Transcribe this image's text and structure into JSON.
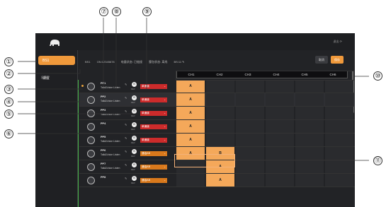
{
  "app": {
    "top_right_label": "退出 ⟳",
    "sidebar_items": [
      {
        "label": "BS1",
        "active": true
      },
      {
        "label": "设置",
        "active": false
      }
    ],
    "info": {
      "name_prefix": "BS1",
      "id": "ON:12345678",
      "battery": "电量状态: 已链接",
      "belt": "腰包状态: 离线",
      "bs": "BS:11 ✎"
    },
    "buttons": {
      "cancel": "取消",
      "save": "保存"
    },
    "list_header": "设备",
    "channels": [
      "CH1",
      "CH2",
      "CH3",
      "CH4",
      "CH5",
      "CH6"
    ],
    "devices": [
      {
        "name": "PP1",
        "sub": "Talk&Voice Listen",
        "badge": "B",
        "badge_sub": "DEV",
        "mode": "单通道",
        "mode_color": "red",
        "cells": [
          "A",
          "",
          "",
          "",
          "",
          ""
        ],
        "selected": false
      },
      {
        "name": "PP2",
        "sub": "Talk&Voice Listen",
        "badge": "B",
        "badge_sub": "DEV",
        "mode": "单通道",
        "mode_color": "red",
        "cells": [
          "A",
          "",
          "",
          "",
          "",
          ""
        ],
        "selected": true
      },
      {
        "name": "PP3",
        "sub": "Talk&Voice Listen",
        "badge": "B",
        "badge_sub": "DEV",
        "mode": "单通道",
        "mode_color": "red",
        "cells": [
          "A",
          "",
          "",
          "",
          "",
          ""
        ],
        "selected": false
      },
      {
        "name": "PP4",
        "sub": "",
        "badge": "B",
        "badge_sub": "DEV",
        "mode": "单通道",
        "mode_color": "red",
        "cells": [
          "A",
          "",
          "",
          "",
          "",
          ""
        ],
        "selected": false
      },
      {
        "name": "PP5",
        "sub": "Talk&Voice Listen",
        "badge": "B",
        "badge_sub": "DEV",
        "mode": "单通道",
        "mode_color": "red",
        "cells": [
          "A",
          "",
          "",
          "",
          "",
          ""
        ],
        "selected": false
      },
      {
        "name": "PP6",
        "sub": "Talk&Voice Listen",
        "badge": "B",
        "badge_sub": "DEV",
        "mode": "通话AB",
        "mode_color": "orange",
        "cells": [
          "A",
          "B",
          "",
          "",
          "",
          ""
        ],
        "selected": false
      },
      {
        "name": "PP7",
        "sub": "Talk&Voice Listen",
        "badge": "B",
        "badge_sub": "DEV",
        "mode": "通话AB",
        "mode_color": "orange",
        "cells": [
          "",
          "A",
          "",
          "",
          "",
          ""
        ],
        "selected": false
      },
      {
        "name": "PP8",
        "sub": "",
        "badge": "B",
        "badge_sub": "DEV",
        "mode": "通话AB",
        "mode_color": "orange",
        "cells": [
          "",
          "A",
          "",
          "",
          "",
          ""
        ],
        "selected": false
      }
    ],
    "colors": {
      "accent": "#f0993b",
      "red_mode": "#cc2b2b",
      "orange_mode": "#d9791c",
      "cell_on": "#f4a85a"
    }
  },
  "annotations": [
    "①",
    "②",
    "③",
    "④",
    "⑤",
    "⑥",
    "⑦",
    "⑧",
    "⑨",
    "⑩",
    "⑪"
  ]
}
